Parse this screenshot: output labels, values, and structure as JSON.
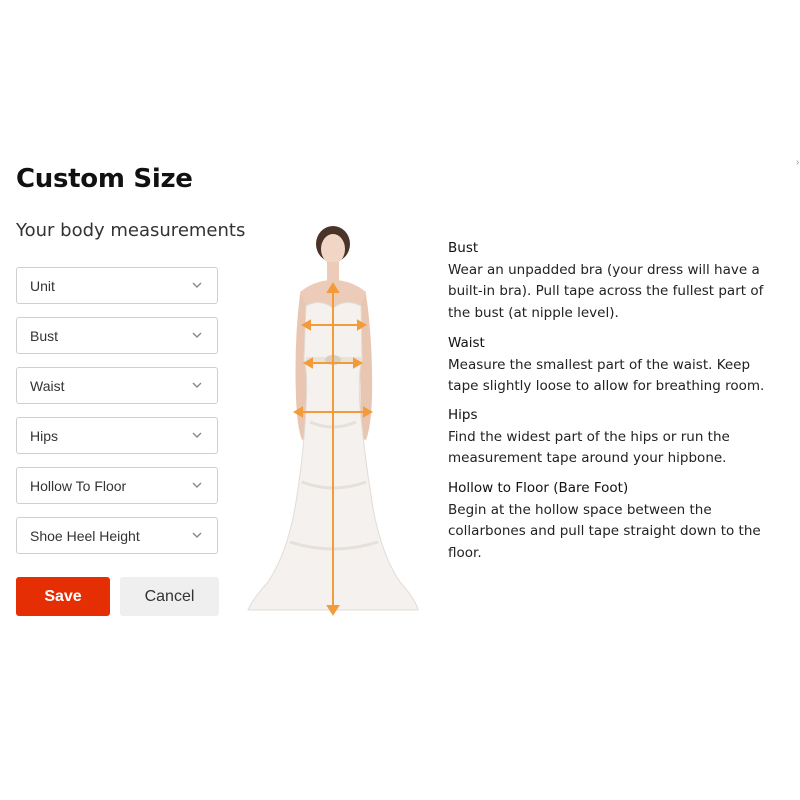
{
  "page": {
    "title": "Custom Size",
    "subtitle": "Your body measurements"
  },
  "fields": [
    {
      "label": "Unit"
    },
    {
      "label": "Bust"
    },
    {
      "label": "Waist"
    },
    {
      "label": "Hips"
    },
    {
      "label": "Hollow To Floor"
    },
    {
      "label": "Shoe Heel Height"
    }
  ],
  "buttons": {
    "save": "Save",
    "cancel": "Cancel"
  },
  "guide": [
    {
      "heading": "Bust",
      "text": "Wear an unpadded bra (your dress will have a built-in bra). Pull tape across the fullest part of the bust (at nipple level)."
    },
    {
      "heading": "Waist",
      "text": "Measure the smallest part of the waist. Keep tape slightly loose to allow for breathing room."
    },
    {
      "heading": "Hips",
      "text": "Find the widest part of the hips or run the measurement tape around your hipbone."
    },
    {
      "heading": "Hollow to Floor (Bare Foot)",
      "text": "Begin at the hollow space between the collarbones and pull tape straight down to the floor."
    }
  ],
  "colors": {
    "accent": "#e62e04",
    "measure_line": "#f39a3a",
    "cancel_bg": "#efefef"
  },
  "icons": {
    "select_arrow": "chevron-down-icon",
    "model_image": "bride-model-image"
  }
}
